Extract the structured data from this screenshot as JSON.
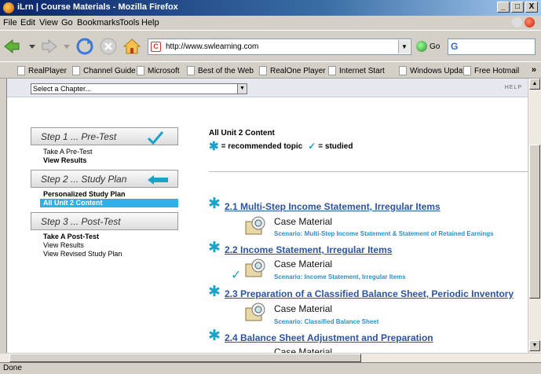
{
  "window": {
    "title": "iLrn | Course Materials - Mozilla Firefox",
    "min": "_",
    "max": "□",
    "close": "X"
  },
  "menu": [
    "File",
    "Edit",
    "View",
    "Go",
    "Bookmarks",
    "Tools",
    "Help"
  ],
  "nav": {
    "url": "http://www.swlearning.com",
    "go_label": "Go",
    "search_value": "G"
  },
  "bookmarks": [
    "RealPlayer",
    "Channel Guide",
    "Microsoft",
    "Best of the Web",
    "RealOne Player",
    "Internet Start",
    "Windows Update",
    "Free Hotmail"
  ],
  "bookmarks_more": "»",
  "page": {
    "chapter_select": "Select a Chapter...",
    "help": "HELP",
    "steps": [
      {
        "label": "Step 1 ... Pre-Test",
        "links": [
          "Take A Pre-Test",
          "View Results"
        ]
      },
      {
        "label": "Step 2 ... Study Plan",
        "links": [
          "Personalized Study Plan",
          "All Unit 2 Content"
        ]
      },
      {
        "label": "Step 3 ... Post-Test",
        "links": [
          "Take A Post-Test",
          "View Results",
          "View Revised Study Plan"
        ]
      }
    ],
    "content_title": "All Unit 2 Content",
    "legend": {
      "recommended": "= recommended topic",
      "studied": "= studied"
    },
    "topics": [
      {
        "title": "2.1 Multi-Step Income Statement, Irregular Items",
        "case": "Case Material",
        "scenario": "Scenario: Multi-Step Income Statement & Statement of Retained Earnings"
      },
      {
        "title": "2.2 Income Statement, Irregular Items",
        "case": "Case Material",
        "scenario": "Scenario: Income Statement, Irregular Items"
      },
      {
        "title": "2.3 Preparation of a Classified Balance Sheet, Periodic Inventory",
        "case": "Case Material",
        "scenario": "Scenario: Classified Balance Sheet"
      },
      {
        "title": "2.4 Balance Sheet Adjustment and Preparation",
        "case": "Case Material"
      }
    ]
  },
  "status": "Done",
  "colors": {
    "accent": "#1aa3c9",
    "link": "#2b55a0",
    "active": "#2fb0e6"
  }
}
